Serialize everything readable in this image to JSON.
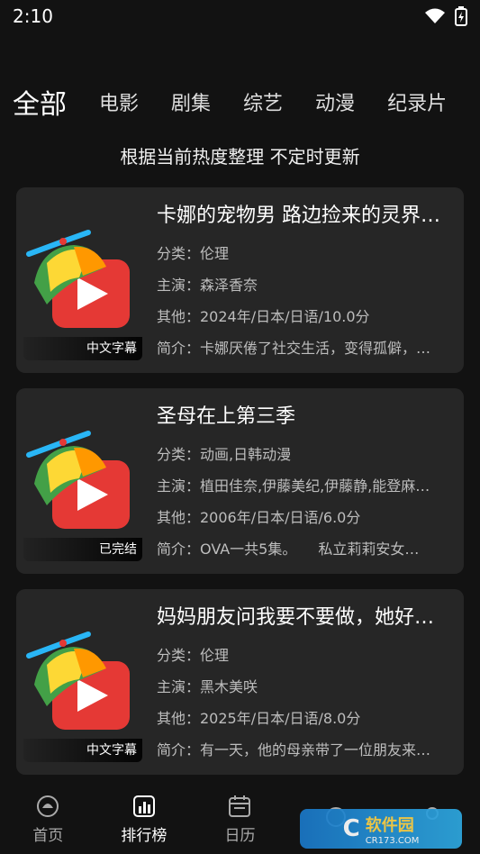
{
  "status": {
    "time": "2:10"
  },
  "tabs": [
    {
      "label": "全部"
    },
    {
      "label": "电影"
    },
    {
      "label": "剧集"
    },
    {
      "label": "综艺"
    },
    {
      "label": "动漫"
    },
    {
      "label": "纪录片"
    }
  ],
  "subtitle": "根据当前热度整理 不定时更新",
  "cards": [
    {
      "title": "卡娜的宠物男 路边捡来的灵界…",
      "tag": "中文字幕",
      "category": "分类：伦理",
      "cast": "主演：森泽香奈",
      "other": "其他：2024年/日本/日语/10.0分",
      "intro": "简介：卡娜厌倦了社交生活，变得孤僻，…"
    },
    {
      "title": "圣母在上第三季",
      "tag": "已完结",
      "category": "分类：动画,日韩动漫",
      "cast": "主演：植田佳奈,伊藤美纪,伊藤静,能登麻…",
      "other": "其他：2006年/日本/日语/6.0分",
      "intro": "简介：OVA一共5集。　　私立莉莉安女…"
    },
    {
      "title": "妈妈朋友问我要不要做，她好…",
      "tag": "中文字幕",
      "category": "分类：伦理",
      "cast": "主演：黑木美咲",
      "other": "其他：2025年/日本/日语/8.0分",
      "intro": "简介：有一天，他的母亲带了一位朋友来…"
    }
  ],
  "nav": [
    {
      "label": "首页",
      "icon": "home-icon"
    },
    {
      "label": "排行榜",
      "icon": "ranking-icon"
    },
    {
      "label": "日历",
      "icon": "calendar-icon"
    },
    {
      "label": "",
      "icon": "discover-icon"
    },
    {
      "label": "",
      "icon": "profile-icon"
    }
  ],
  "watermark": {
    "main": "软件园",
    "sub": "CR173.COM"
  }
}
